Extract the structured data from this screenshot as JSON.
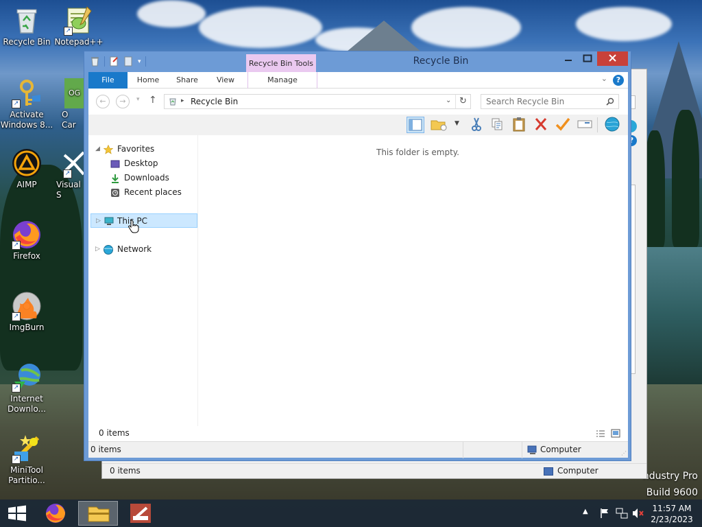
{
  "desktop": {
    "icons": [
      {
        "label": "Recycle Bin",
        "icon": "recycle-bin-icon"
      },
      {
        "label": "Notepad++",
        "icon": "notepad-plus-plus-icon"
      },
      {
        "label": "Activate Windows 8...",
        "icon": "activate-windows-key-icon"
      },
      {
        "label": "O Car",
        "icon": "og-app-icon"
      },
      {
        "label": "AIMP",
        "icon": "aimp-icon"
      },
      {
        "label": "Visual S",
        "icon": "visual-studio-icon"
      },
      {
        "label": "Firefox",
        "icon": "firefox-icon"
      },
      {
        "label": "ImgBurn",
        "icon": "imgburn-icon"
      },
      {
        "label": "Internet Downlo...",
        "icon": "internet-download-manager-icon"
      },
      {
        "label": "MiniTool Partitio...",
        "icon": "minitool-partition-icon"
      }
    ],
    "og_badge": "OG",
    "watermark_line1": "ndustry Pro",
    "watermark_line2": "Build 9600"
  },
  "background_window": {
    "status_items": "0 items",
    "status_location": "Computer"
  },
  "window": {
    "title": "Recycle Bin",
    "context_tab": "Recycle Bin Tools",
    "ribbon_tabs": {
      "file": "File",
      "home": "Home",
      "share": "Share",
      "view": "View",
      "manage": "Manage"
    },
    "address_path": "Recycle Bin",
    "search_placeholder": "Search Recycle Bin",
    "navigation": {
      "favorites": "Favorites",
      "desktop": "Desktop",
      "downloads": "Downloads",
      "recent_places": "Recent places",
      "this_pc": "This PC",
      "network": "Network"
    },
    "empty_message": "This folder is empty.",
    "info_count": "0 items",
    "status_count": "0 items",
    "status_location": "Computer"
  },
  "taskbar": {
    "time": "11:57 AM",
    "date": "2/23/2023"
  },
  "colors": {
    "accent_blue": "#1979ca",
    "window_frame": "#6d9bd6",
    "context_tab": "#eac9f0",
    "close_button": "#c8413a",
    "selection": "#cce8ff"
  }
}
